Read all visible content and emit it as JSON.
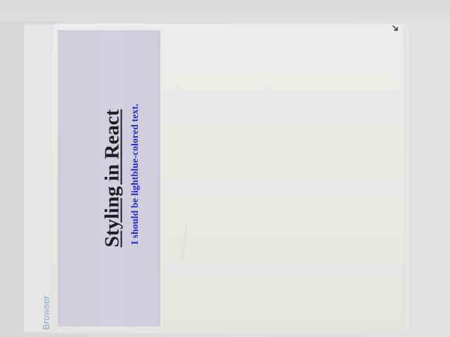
{
  "sidebar": {
    "browser_label": "Browser"
  },
  "page": {
    "heading": "Styling in React",
    "subtext": "I should be lightblue-colored text."
  },
  "colors": {
    "panel_background": "#d0d0de",
    "heading_text": "#1d1d22",
    "subtext": "#2727c8",
    "browser_label": "#8aa6c8"
  }
}
